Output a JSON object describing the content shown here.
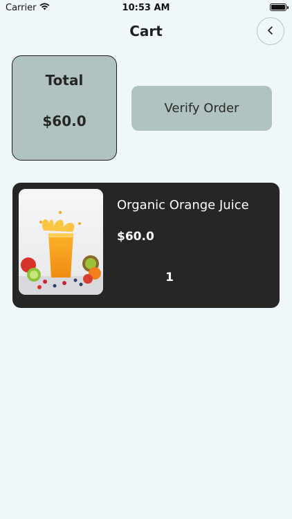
{
  "status_bar": {
    "carrier": "Carrier",
    "time": "10:53 AM"
  },
  "header": {
    "title": "Cart",
    "back_icon": "chevron-left-icon"
  },
  "summary": {
    "total_label": "Total",
    "total_value": "$60.0",
    "verify_label": "Verify Order"
  },
  "cart_items": [
    {
      "name": "Organic Orange Juice",
      "price": "$60.0",
      "quantity": "1",
      "image_icon": "orange-juice-photo"
    }
  ],
  "colors": {
    "background": "#f0f7fa",
    "card_sage": "#b0c3c0",
    "item_dark": "#262626"
  }
}
